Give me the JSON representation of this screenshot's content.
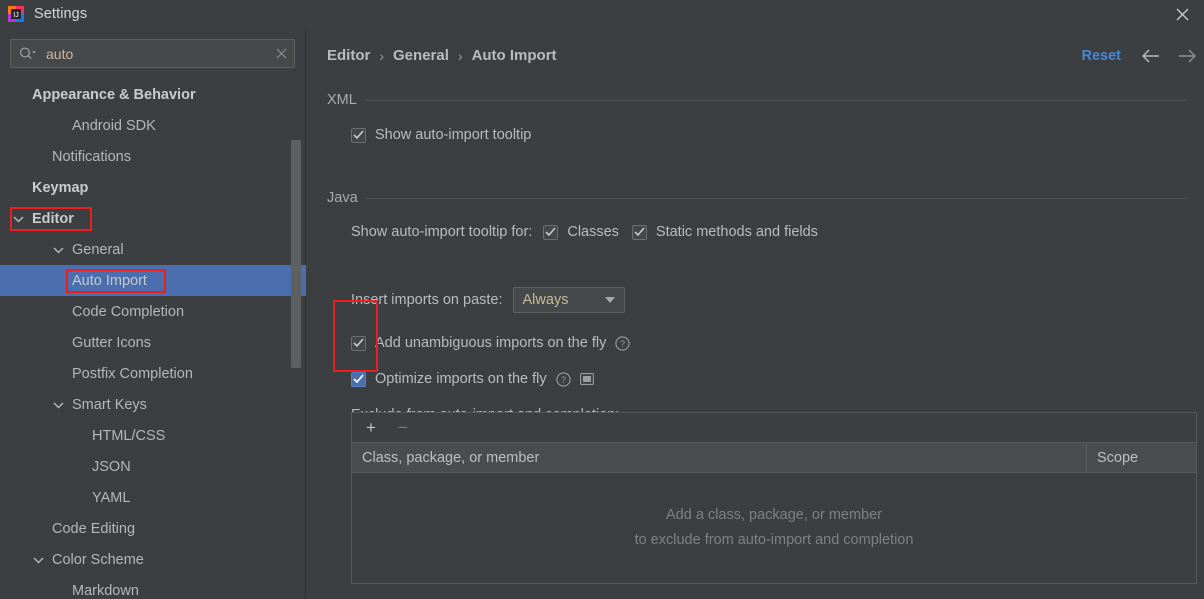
{
  "window": {
    "title": "Settings",
    "logo_icon": "intellij-idea-logo-icon",
    "close_icon": "close-icon"
  },
  "search": {
    "value": "auto",
    "placeholder": "",
    "icon": "search-icon",
    "clear_icon": "clear-icon"
  },
  "sidebar": {
    "items": [
      {
        "label": "Appearance & Behavior",
        "indent": 32,
        "bold": true,
        "arrow": "none",
        "selected": false,
        "highlighted": false
      },
      {
        "label": "Android SDK",
        "indent": 72,
        "bold": false,
        "arrow": "none",
        "selected": false,
        "highlighted": false
      },
      {
        "label": "Notifications",
        "indent": 52,
        "bold": false,
        "arrow": "none",
        "selected": false,
        "highlighted": false
      },
      {
        "label": "Keymap",
        "indent": 32,
        "bold": true,
        "arrow": "none",
        "selected": false,
        "highlighted": false
      },
      {
        "label": "Editor",
        "indent": 32,
        "bold": true,
        "arrow": "chevron-down",
        "selected": false,
        "highlighted": true
      },
      {
        "label": "General",
        "indent": 72,
        "bold": false,
        "arrow": "chevron-down",
        "selected": false,
        "highlighted": false
      },
      {
        "label": "Auto Import",
        "indent": 72,
        "bold": false,
        "arrow": "none",
        "selected": true,
        "highlighted": true
      },
      {
        "label": "Code Completion",
        "indent": 72,
        "bold": false,
        "arrow": "none",
        "selected": false,
        "highlighted": false
      },
      {
        "label": "Gutter Icons",
        "indent": 72,
        "bold": false,
        "arrow": "none",
        "selected": false,
        "highlighted": false
      },
      {
        "label": "Postfix Completion",
        "indent": 72,
        "bold": false,
        "arrow": "none",
        "selected": false,
        "highlighted": false
      },
      {
        "label": "Smart Keys",
        "indent": 72,
        "bold": false,
        "arrow": "chevron-down",
        "selected": false,
        "highlighted": false
      },
      {
        "label": "HTML/CSS",
        "indent": 92,
        "bold": false,
        "arrow": "none",
        "selected": false,
        "highlighted": false
      },
      {
        "label": "JSON",
        "indent": 92,
        "bold": false,
        "arrow": "none",
        "selected": false,
        "highlighted": false
      },
      {
        "label": "YAML",
        "indent": 92,
        "bold": false,
        "arrow": "none",
        "selected": false,
        "highlighted": false
      },
      {
        "label": "Code Editing",
        "indent": 52,
        "bold": false,
        "arrow": "none",
        "selected": false,
        "highlighted": false
      },
      {
        "label": "Color Scheme",
        "indent": 52,
        "bold": false,
        "arrow": "chevron-down",
        "selected": false,
        "highlighted": false
      },
      {
        "label": "Markdown",
        "indent": 72,
        "bold": false,
        "arrow": "none",
        "selected": false,
        "highlighted": false
      }
    ]
  },
  "breadcrumb": {
    "items": [
      "Editor",
      "General",
      "Auto Import"
    ],
    "separator": "›"
  },
  "toolbar": {
    "reset_label": "Reset",
    "back_icon": "arrow-left-icon",
    "forward_icon": "arrow-right-icon"
  },
  "sections": {
    "xml": {
      "title": "XML",
      "show_tooltip": {
        "label": "Show auto-import tooltip",
        "checked": true,
        "focused": false
      }
    },
    "java": {
      "title": "Java",
      "tooltip_for_label": "Show auto-import tooltip for:",
      "tooltip_for_options": [
        {
          "label": "Classes",
          "checked": true
        },
        {
          "label": "Static methods and fields",
          "checked": true
        }
      ],
      "insert_imports_label": "Insert imports on paste:",
      "insert_imports_value": "Always",
      "add_unambiguous": {
        "label": "Add unambiguous imports on the fly",
        "checked": true,
        "focused": false,
        "help_icon": "help-circle-icon"
      },
      "optimize_imports": {
        "label": "Optimize imports on the fly",
        "checked": true,
        "focused": true,
        "help_icon": "help-circle-icon",
        "extra_icon": "monitor-icon"
      },
      "exclude_label": "Exclude from auto-import and completion:"
    }
  },
  "table": {
    "add_icon": "+",
    "remove_icon": "−",
    "columns": [
      "Class, package, or member",
      "Scope"
    ],
    "rows": [],
    "empty_text_line1": "Add a class, package, or member",
    "empty_text_line2": "to exclude from auto-import and completion"
  },
  "colors": {
    "background": "#3c3f41",
    "selection": "#4b6eaf",
    "accent_link": "#4a86d8",
    "highlight_box": "#ef1e1e",
    "text": "#b9bcbe",
    "input_text": "#c8b89a"
  }
}
